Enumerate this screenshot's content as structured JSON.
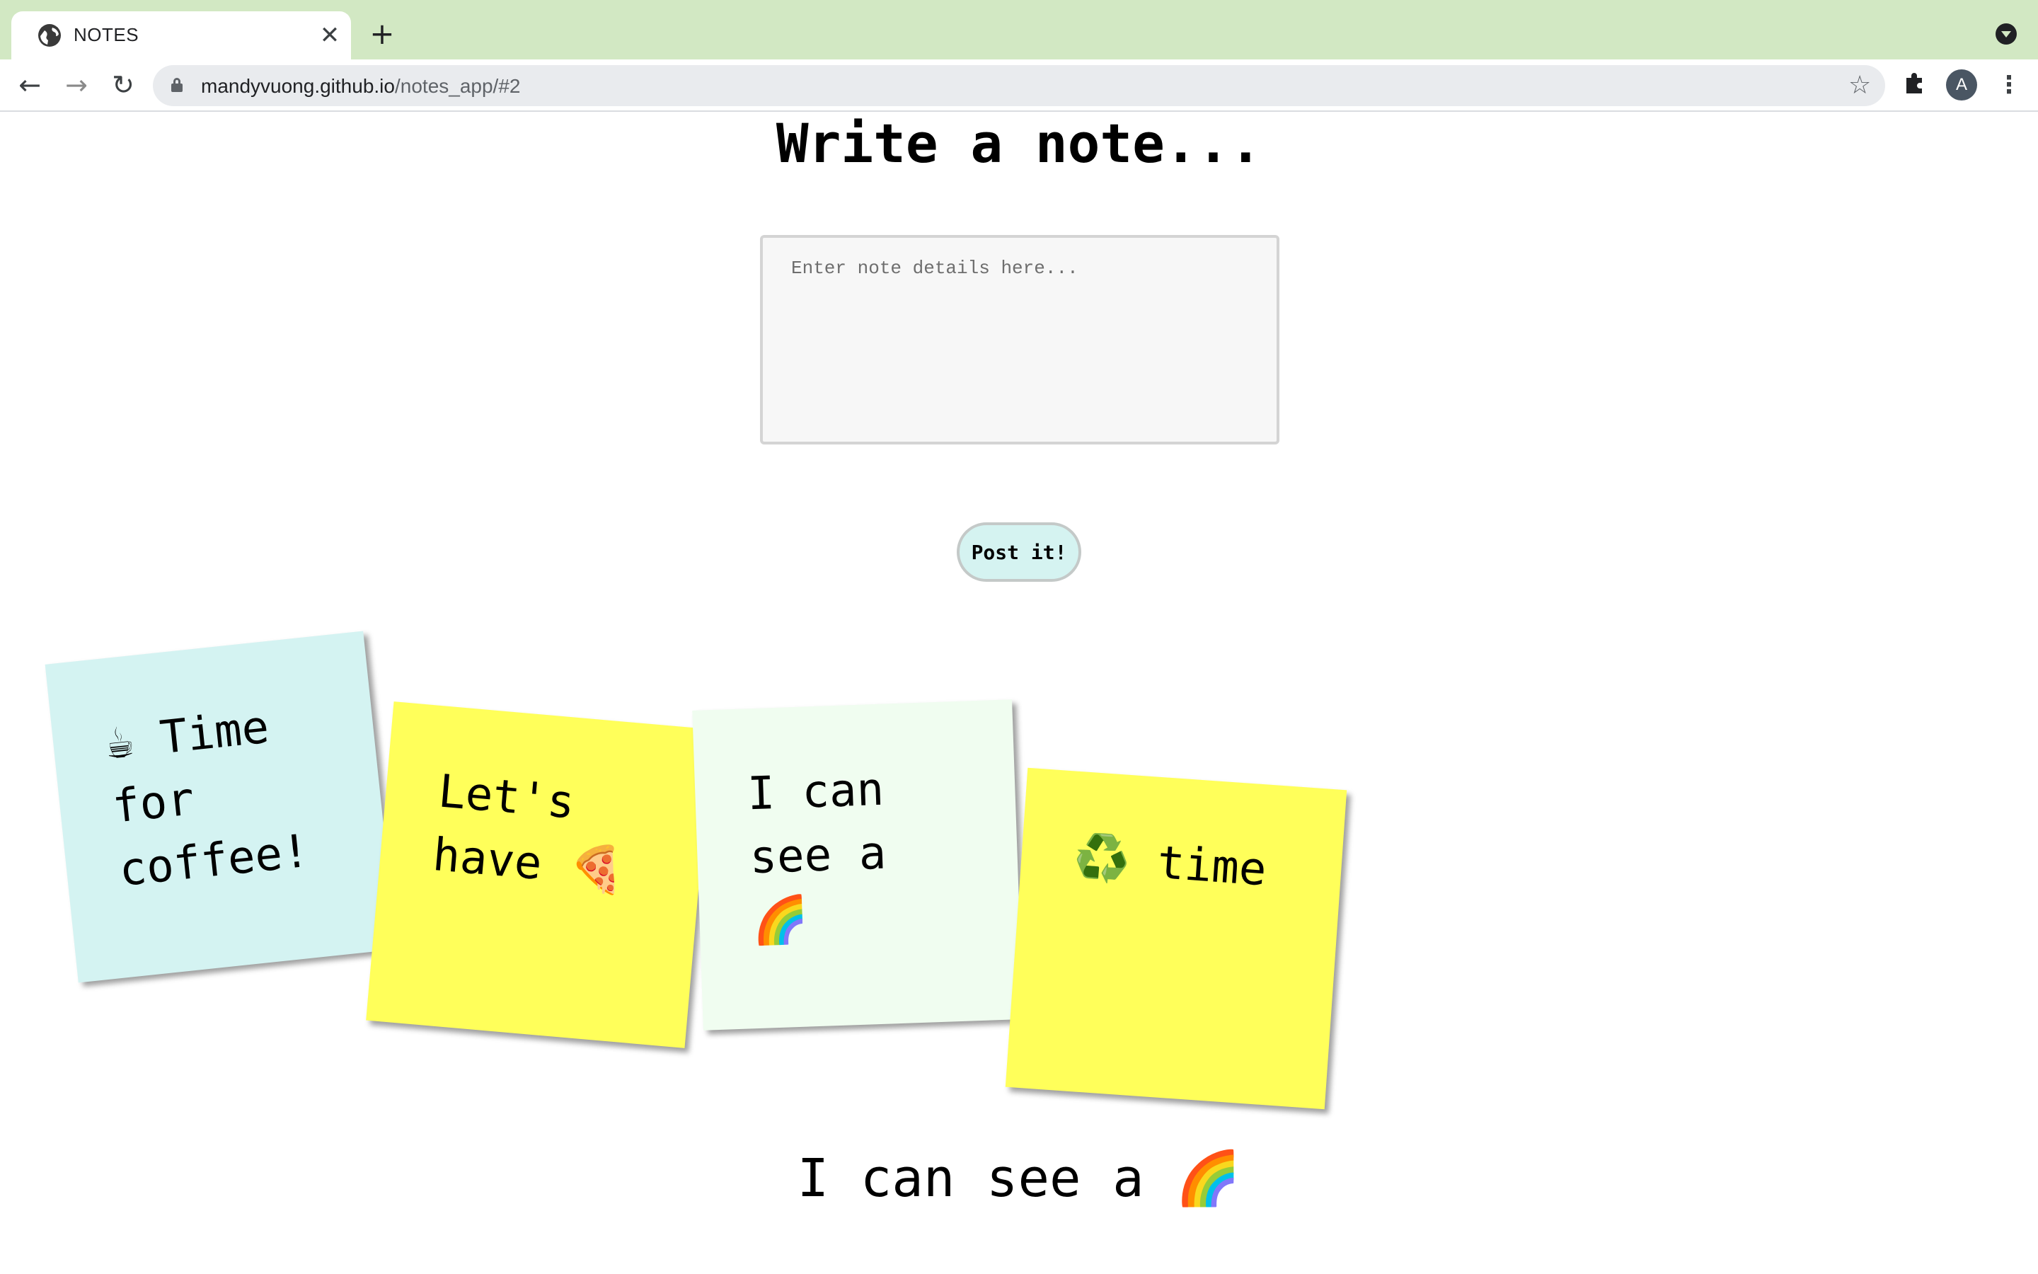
{
  "browser": {
    "tab_title": "NOTES",
    "tab_close": "✕",
    "new_tab": "+",
    "url_host": "mandyvuong.github.io",
    "url_path": "/notes_app/#2",
    "profile_initial": "A",
    "nav": {
      "back": "←",
      "forward": "→",
      "reload": "↻"
    },
    "star": "☆",
    "menu": "⋮",
    "icons": [
      "globe-icon",
      "lock-icon",
      "star-icon",
      "puzzle-icon",
      "avatar",
      "kebab-menu-icon",
      "tab-search-icon"
    ]
  },
  "page": {
    "heading": "Write a note...",
    "input_placeholder": "Enter note details here...",
    "post_button": "Post it!",
    "notes": [
      {
        "text": "☕ Time for coffee!",
        "color": "#d4f3f2"
      },
      {
        "text": "Let's have 🍕",
        "color": "#ffff5a"
      },
      {
        "text": "I can see a 🌈",
        "color": "#f0fdf0"
      },
      {
        "text": "♻️ time",
        "color": "#ffff5a"
      }
    ],
    "preview_text": "I can see a 🌈"
  }
}
